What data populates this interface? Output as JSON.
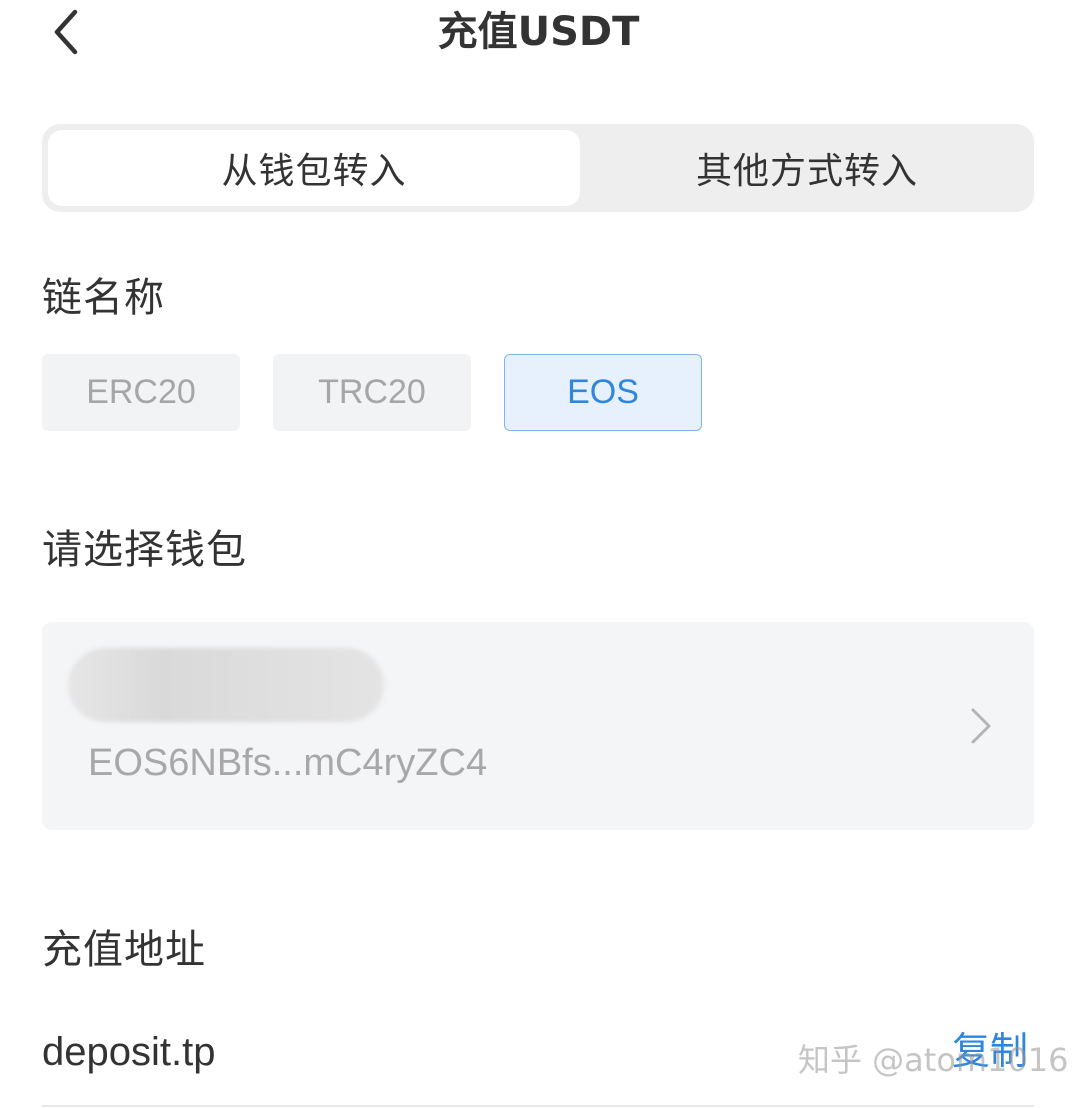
{
  "header": {
    "title": "充值USDT",
    "back_icon": "chevron-left-icon"
  },
  "source_tabs": [
    {
      "label": "从钱包转入",
      "active": true
    },
    {
      "label": "其他方式转入",
      "active": false
    }
  ],
  "chain": {
    "label": "链名称",
    "options": [
      {
        "label": "ERC20",
        "selected": false
      },
      {
        "label": "TRC20",
        "selected": false
      },
      {
        "label": "EOS",
        "selected": true
      }
    ]
  },
  "wallet": {
    "label": "请选择钱包",
    "address": "EOS6NBfs...mC4ryZC4",
    "chevron_icon": "chevron-right-icon"
  },
  "deposit": {
    "label": "充值地址",
    "address": "deposit.tp",
    "copy_label": "复制"
  },
  "watermark": "知乎 @atom1016",
  "colors": {
    "accent": "#2f86dd",
    "selected_bg": "#e7f1fd",
    "chip_bg": "#f2f3f5",
    "segment_bg": "#eeeeee"
  }
}
